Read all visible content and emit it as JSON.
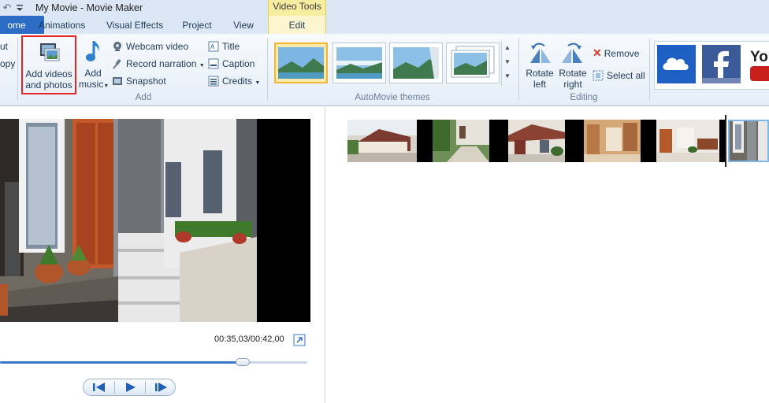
{
  "window": {
    "title": "My Movie - Movie Maker"
  },
  "contextual": {
    "header": "Video Tools",
    "tab": "Edit"
  },
  "tabs": [
    "ome",
    "Animations",
    "Visual Effects",
    "Project",
    "View"
  ],
  "clipboard": {
    "cut": "ut",
    "copy": "opy"
  },
  "add_group": {
    "add_media_line1": "Add videos",
    "add_media_line2": "and photos",
    "add_music_line1": "Add",
    "add_music_line2": "music",
    "webcam": "Webcam video",
    "narration": "Record narration",
    "snapshot": "Snapshot",
    "title": "Title",
    "caption": "Caption",
    "credits": "Credits",
    "label": "Add"
  },
  "themes": {
    "label": "AutoMovie themes",
    "selected_index": 0
  },
  "editing": {
    "rotate_left_1": "Rotate",
    "rotate_left_2": "left",
    "rotate_right_1": "Rotate",
    "rotate_right_2": "right",
    "remove": "Remove",
    "select_all": "Select all",
    "label": "Editing"
  },
  "social": {
    "youtube_partial": "You"
  },
  "preview": {
    "time": "00:35,03/00:42,00",
    "progress": 0.79
  },
  "colors": {
    "accent": "#2c6cc4",
    "highlight": "#e52525",
    "context": "#f7eda0"
  }
}
